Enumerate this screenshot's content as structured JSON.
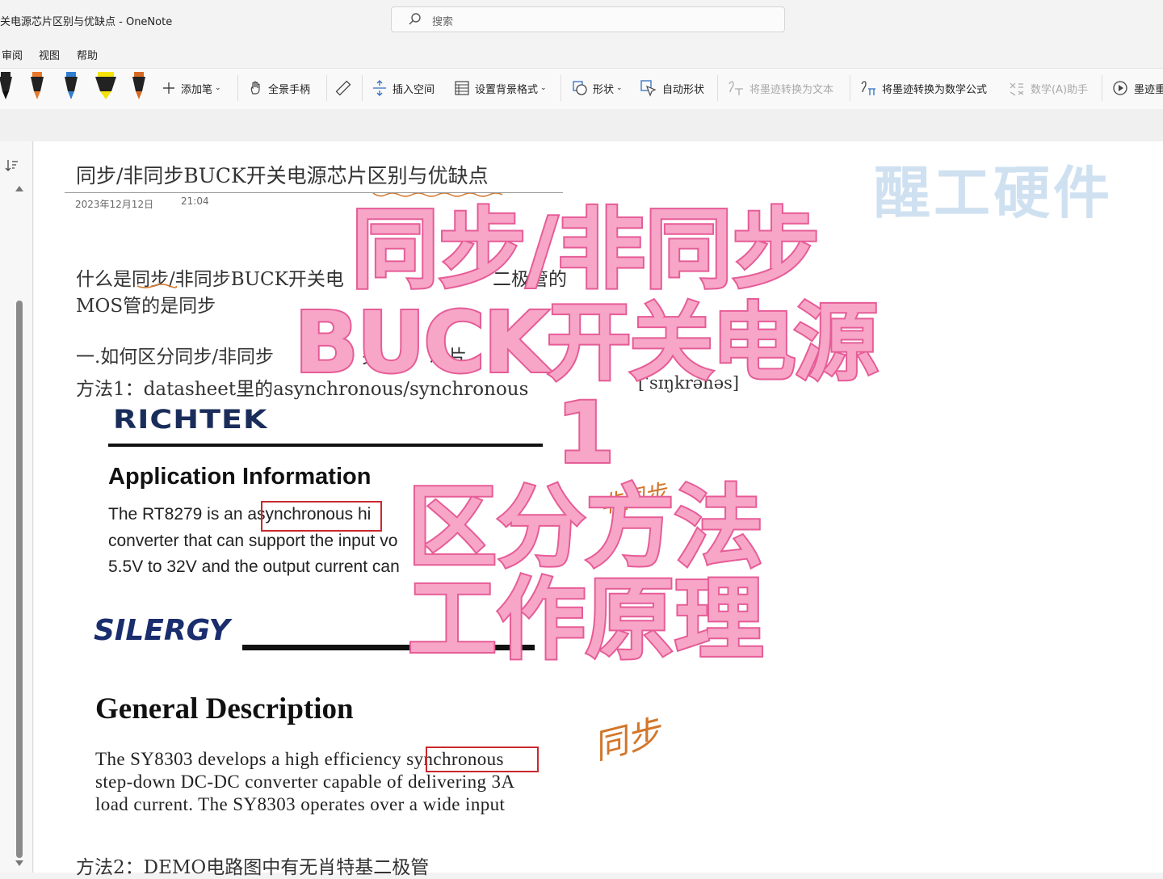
{
  "window": {
    "title": "关电源芯片区别与优缺点 - OneNote"
  },
  "search": {
    "placeholder": "搜索"
  },
  "menu": [
    "审阅",
    "视图",
    "帮助"
  ],
  "ribbon": {
    "add_pen": "添加笔",
    "full_hand": "全景手柄",
    "insert_space": "插入空间",
    "background": "设置背景格式",
    "shapes": "形状",
    "auto_shapes": "自动形状",
    "ink_to_text": "将墨迹转换为文本",
    "ink_to_math": "将墨迹转换为数学公式",
    "math_assistant": "数学(A)助手",
    "ink_replay": "墨迹重"
  },
  "page": {
    "title": "同步/非同步BUCK开关电源芯片区别与优缺点",
    "date": "2023年12月12日",
    "time": "21:04",
    "watermark": "醒工硬件",
    "line1": "什么是同步/非同步BUCK开关电",
    "line1_tail": "二极管的",
    "line2": "MOS管的是同步",
    "heading1": "一.如何区分同步/非同步",
    "heading1_tail": "关",
    "heading1_tail2": "芯片",
    "method1": "方法1：datasheet里的asynchronous/synchronous",
    "method1_phonetic": "[ˈsɪŋkrənəs]",
    "method2": "方法2：DEMO电路图中有无肖特基二极管"
  },
  "richtek": {
    "logo": "RICHTEK",
    "heading": "Application Information",
    "lines": [
      "The RT8279 is an asynchronous hi",
      "converter that can support the input vo",
      "5.5V to 32V and the output current can"
    ],
    "highlight": "asynchronous"
  },
  "silergy": {
    "logo": "SILERGY",
    "heading": "General Description",
    "lines": [
      "The SY8303 develops a high efficiency synchronous",
      "step-down DC-DC converter capable of delivering 3A",
      "load current. The SY8303 operates over a wide input"
    ],
    "highlight": "synchronous"
  },
  "overlay": [
    "同步/非同步",
    "BUCK开关电源",
    "1",
    "区分方法",
    "工作原理"
  ],
  "handwriting": {
    "note1": "非同步",
    "note2": "同步"
  },
  "colors": {
    "overlay_fill": "#f7a6c8",
    "overlay_stroke": "#e65c97",
    "highlight_box": "#c9282d",
    "ink": "#d2762a",
    "watermark": "#cfe1f1"
  }
}
